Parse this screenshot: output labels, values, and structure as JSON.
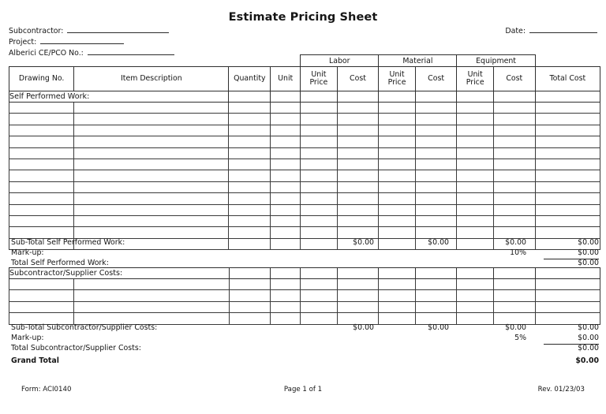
{
  "document": {
    "title": "Estimate Pricing Sheet"
  },
  "header_fields": {
    "subcontractor_label": "Subcontractor:",
    "project_label": "Project:",
    "ce_pco_label": "Alberici CE/PCO No.:",
    "date_label": "Date:"
  },
  "table": {
    "group_headers": {
      "labor": "Labor",
      "material": "Material",
      "equipment": "Equipment"
    },
    "columns": [
      "Drawing No.",
      "Item Description",
      "Quantity",
      "Unit",
      "Unit Price",
      "Cost",
      "Unit Price",
      "Cost",
      "Unit Price",
      "Cost",
      "Total Cost"
    ],
    "column_labels": {
      "drawing_no": "Drawing No.",
      "item_description": "Item Description",
      "quantity": "Quantity",
      "unit": "Unit",
      "unit_price_1": "Unit",
      "unit_price_1b": "Price",
      "cost_1": "Cost",
      "unit_price_2": "Unit",
      "unit_price_2b": "Price",
      "cost_2": "Cost",
      "unit_price_3": "Unit",
      "unit_price_3b": "Price",
      "cost_3": "Cost",
      "total_cost": "Total Cost"
    },
    "sections": [
      {
        "id": "self-performed",
        "label": "Self Performed Work:",
        "blank_rows": 13
      },
      {
        "id": "subcontractor-supplier",
        "label": "Subcontractor/Supplier Costs:",
        "blank_rows": 4
      }
    ]
  },
  "summaries": {
    "self_performed": {
      "subtotal_label": "Sub-Total Self Performed Work:",
      "subtotal_labor": "$0.00",
      "subtotal_material": "$0.00",
      "subtotal_equipment": "$0.00",
      "subtotal_total": "$0.00",
      "markup_label": "Mark-up:",
      "markup_percent": "10%",
      "markup_total": "$0.00",
      "total_label": "Total Self Performed Work:",
      "total_total": "$0.00"
    },
    "subcontractor": {
      "subtotal_label": "Sub-Total Subcontractor/Supplier Costs:",
      "subtotal_labor": "$0.00",
      "subtotal_material": "$0.00",
      "subtotal_equipment": "$0.00",
      "subtotal_total": "$0.00",
      "markup_label": "Mark-up:",
      "markup_percent": "5%",
      "markup_total": "$0.00",
      "total_label": "Total Subcontractor/Supplier Costs:",
      "total_total": "$0.00"
    },
    "grand_total": {
      "label": "Grand Total",
      "value": "$0.00"
    }
  },
  "footer": {
    "form": "Form: ACI0140",
    "page": "Page 1 of 1",
    "revision": "Rev. 01/23/03"
  },
  "colors": {
    "ink": "#161616",
    "rule": "#2f2f2f",
    "background": "#ffffff"
  }
}
